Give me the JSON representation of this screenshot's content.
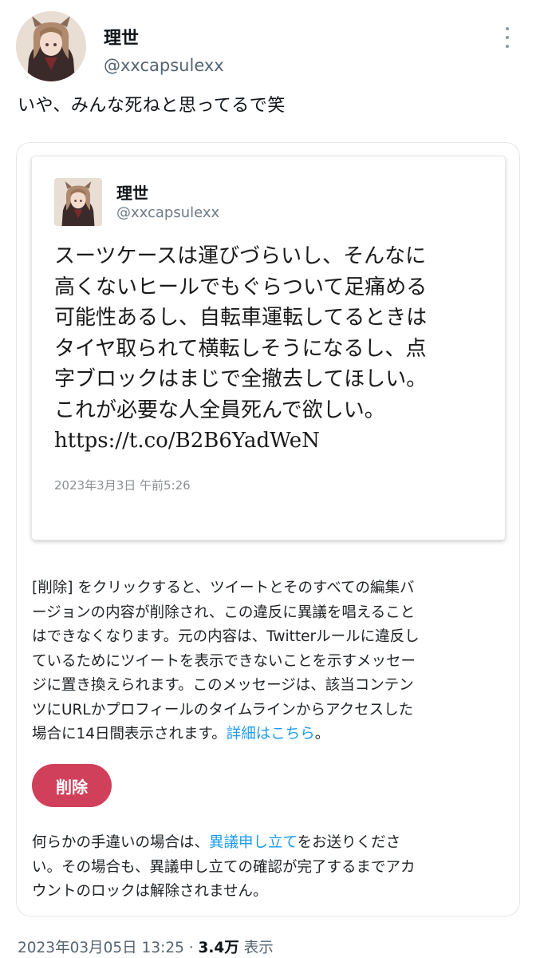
{
  "tweet": {
    "display_name": "理世",
    "handle": "@xxcapsulexx",
    "text": "いや、みんな死ねと思ってるで笑"
  },
  "embedded_tweet": {
    "display_name": "理世",
    "handle": "@xxcapsulexx",
    "lines": [
      "スーツケースは運びづらいし、そんなに",
      "高くないヒールでもぐらついて足痛める",
      "可能性あるし、自転車運転してるときは",
      "タイヤ取られて横転しそうになるし、点",
      "字ブロックはまじで全撤去してほしい。",
      "これが必要な人全員死んで欲しい。",
      "https://t.co/B2B6YadWeN"
    ],
    "date": "2023年3月3日 午前5:26"
  },
  "notice": {
    "lines": [
      "[削除] をクリックすると、ツイートとそのすべての編集バ",
      "ージョンの内容が削除され、この違反に異議を唱えること",
      "はできなくなります。元の内容は、Twitterルールに違反し",
      "ているためにツイートを表示できないことを示すメッセー",
      "ジに置き換えられます。このメッセージは、該当コンテン",
      "ツにURLかプロフィールのタイムラインからアクセスした"
    ],
    "last_line": "場合に14日間表示されます。",
    "details_link": "詳細はこちら",
    "last_line_end": "。"
  },
  "delete_button": "削除",
  "appeal": {
    "line1_before": "何らかの手違いの場合は、",
    "appeal_link": "異議申し立て",
    "line1_after": "をお送りくださ",
    "lines": [
      "い。その場合も、異議申し立ての確認が完了するまでアカ",
      "ウントのロックは解除されません。"
    ]
  },
  "footer": {
    "timestamp": "2023年03月05日 13:25",
    "separator": "·",
    "views_count": "3.4万",
    "views_label": "表示"
  },
  "colors": {
    "link": "#1d9bf0",
    "delete_button": "#d0405b",
    "secondary_text": "#536471"
  },
  "icons": {
    "more": "more-vertical-icon"
  }
}
